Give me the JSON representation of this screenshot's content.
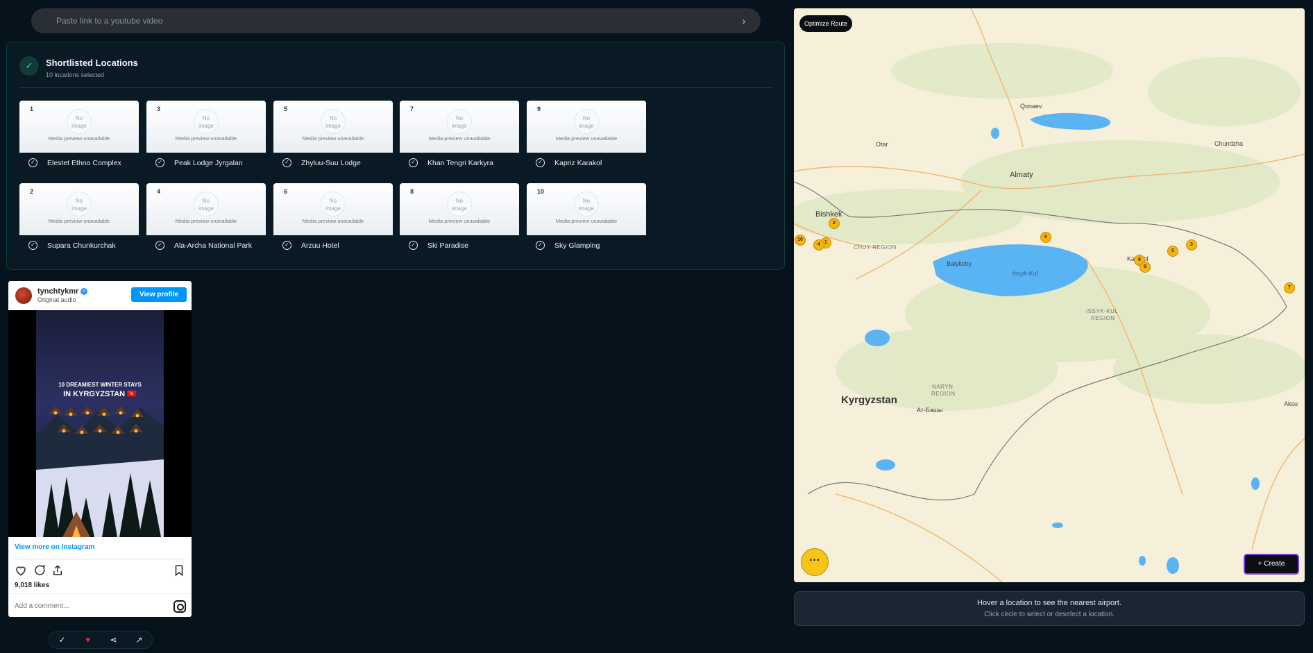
{
  "url_input": {
    "placeholder": "Paste link to a youtube video",
    "go_icon": "chevron-right-icon"
  },
  "shortlist": {
    "title": "Shortlisted Locations",
    "subtitle": "10 locations selected",
    "no_image_text": "No image",
    "unavailable_text": "Media preview unavailable",
    "locations": [
      {
        "num": "1",
        "name": "Elestet Ethno Complex"
      },
      {
        "num": "2",
        "name": "Supara Chunkurchak"
      },
      {
        "num": "3",
        "name": "Peak Lodge Jyrgalan"
      },
      {
        "num": "4",
        "name": "Ala-Archa National Park"
      },
      {
        "num": "5",
        "name": "Zhyluu-Suu Lodge"
      },
      {
        "num": "6",
        "name": "Arzuu Hotel"
      },
      {
        "num": "7",
        "name": "Khan Tengri Karkyra"
      },
      {
        "num": "8",
        "name": "Ski Paradise"
      },
      {
        "num": "9",
        "name": "Kapriz Karakol"
      },
      {
        "num": "10",
        "name": "Sky Glamping"
      }
    ]
  },
  "instagram": {
    "username": "tynchtykmr",
    "audio": "Original audio",
    "view_profile": "View profile",
    "caption_line1": "10 DREAMIEST WINTER STAYS",
    "caption_line2": "IN KYRGYZSTAN 🇰🇬",
    "view_more": "View more on Instagram",
    "likes": "9,018 likes",
    "comment_placeholder": "Add a comment..."
  },
  "actionbar": {
    "icons": [
      "check-circle-icon",
      "heart-icon",
      "share-icon",
      "external-link-icon"
    ]
  },
  "map": {
    "optimize_label": "Optimize Route",
    "create_label": "+ Create",
    "more_label": "···",
    "labels": {
      "qonaev": "Qonaev",
      "otar": "Otar",
      "chundzha": "Chundzha",
      "almaty": "Almaty",
      "bishkek": "Bishkek",
      "chuy": "CHUY REGION",
      "balykchy": "Balykchy",
      "issyk_kul_lake": "Issyk-Kul",
      "karakol": "Karakol",
      "issyk_kul_region_1": "ISSYK-KUL",
      "issyk_kul_region_2": "REGION",
      "naryn_1": "NARYN",
      "naryn_2": "REGION",
      "at_bashy": "Ат-Башы",
      "kyrgyzstan": "Kyrgyzstan",
      "aksu": "Aksu"
    },
    "markers": [
      "1",
      "2",
      "3",
      "4",
      "5",
      "6",
      "7",
      "8",
      "9",
      "10"
    ]
  },
  "hint": {
    "line1": "Hover a location to see the nearest airport.",
    "line2": "Click circle to select or deselect a location."
  },
  "colors": {
    "accent": "#f5b50f",
    "create_border": "#7c3aed",
    "ig_blue": "#0095f6"
  }
}
